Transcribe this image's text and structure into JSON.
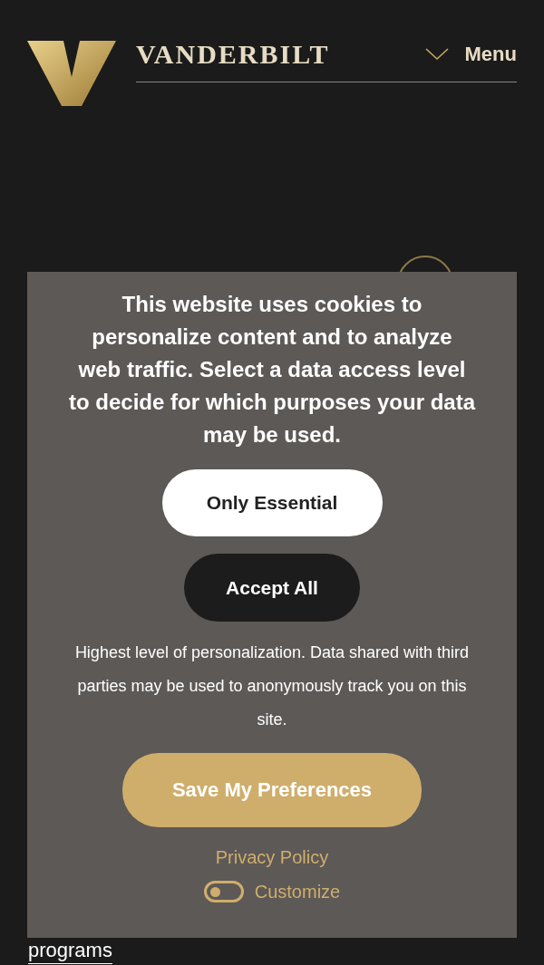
{
  "header": {
    "wordmark": "VANDERBILT",
    "menu": "Menu"
  },
  "page": {
    "link_text": "programs"
  },
  "cookie_banner": {
    "message": "This website uses cookies to personalize content and to analyze web traffic. Select a data access level to decide for which purposes your data may be used.",
    "buttons": [
      {
        "label": "Only Essential",
        "kind": "light"
      },
      {
        "label": "Accept All",
        "kind": "dark"
      }
    ],
    "description": "Highest level of personalization. Data shared with third parties may be used to anonymously track you on this site.",
    "save_button": "Save My Preferences",
    "privacy_link": "Privacy Policy",
    "customize": {
      "label": "Customize",
      "on": false
    }
  }
}
